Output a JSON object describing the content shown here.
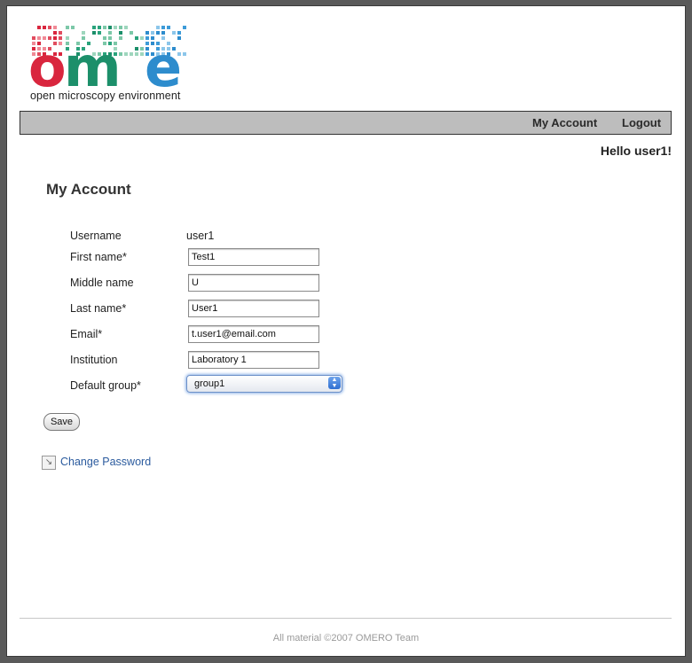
{
  "logo": {
    "text": "ome",
    "tagline": "open microscopy environment",
    "colors": {
      "o": "#d9263e",
      "m": "#1c8f6a",
      "e": "#2d8ccd"
    }
  },
  "nav": {
    "my_account": "My Account",
    "logout": "Logout"
  },
  "greeting": "Hello user1!",
  "page_title": "My Account",
  "form": {
    "username_label": "Username",
    "username_value": "user1",
    "first_name_label": "First name*",
    "first_name_value": "Test1",
    "middle_name_label": "Middle name",
    "middle_name_value": "U",
    "last_name_label": "Last name*",
    "last_name_value": "User1",
    "email_label": "Email*",
    "email_value": "t.user1@email.com",
    "institution_label": "Institution",
    "institution_value": "Laboratory 1",
    "default_group_label": "Default group*",
    "default_group_value": "group1"
  },
  "save_label": "Save",
  "change_password_label": "Change Password",
  "footer": "All material ©2007 OMERO Team",
  "colors": {
    "navbar_bg": "#bdbdbd",
    "link": "#2b5b9e"
  }
}
